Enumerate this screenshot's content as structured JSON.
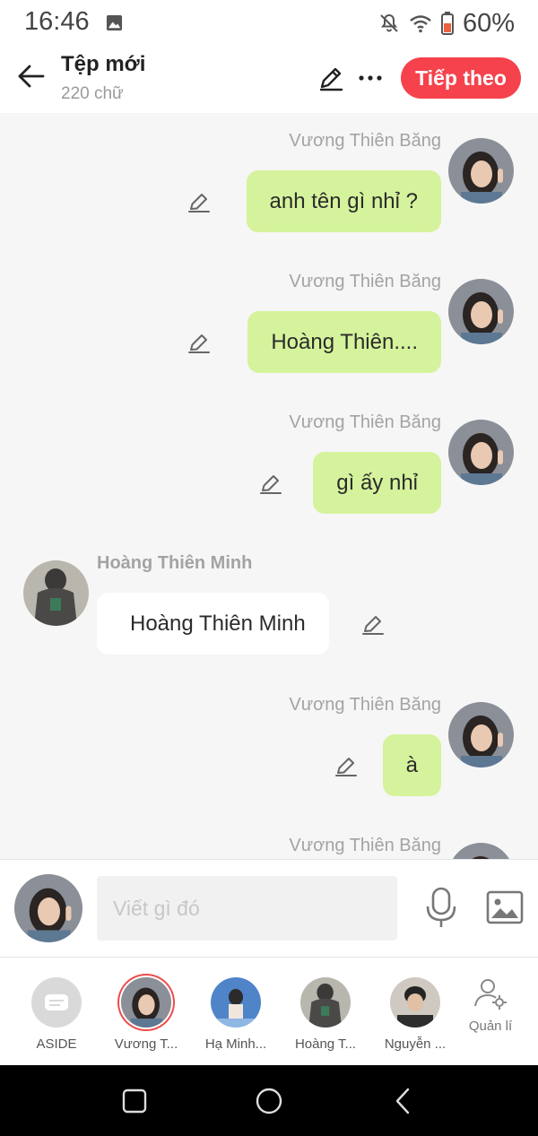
{
  "status_bar": {
    "time": "16:46",
    "battery": "60%",
    "icons": [
      "image-icon",
      "bell-off-icon",
      "wifi-icon",
      "battery-icon"
    ]
  },
  "header": {
    "title": "Tệp mới",
    "subtitle": "220 chữ",
    "next_label": "Tiếp theo",
    "icons": [
      "back-arrow-icon",
      "pencil-icon",
      "more-icon"
    ]
  },
  "messages": [
    {
      "side": "right",
      "sender": "Vương Thiên Băng",
      "text": "anh tên gì nhỉ ?"
    },
    {
      "side": "right",
      "sender": "Vương Thiên Băng",
      "text": "Hoàng Thiên...."
    },
    {
      "side": "right",
      "sender": "Vương Thiên Băng",
      "text": "gì ấy nhỉ"
    },
    {
      "side": "left",
      "sender": "Hoàng Thiên Minh",
      "text": "Hoàng Thiên Minh"
    },
    {
      "side": "right",
      "sender": "Vương Thiên Băng",
      "text": "à"
    },
    {
      "side": "right",
      "sender": "Vương Thiên Băng",
      "text": ""
    }
  ],
  "composer": {
    "placeholder": "Viết gì đó",
    "icons": [
      "microphone-icon",
      "image-icon"
    ]
  },
  "characters": [
    {
      "name": "ASIDE"
    },
    {
      "name": "Vương T...",
      "selected": true
    },
    {
      "name": "Hạ Minh..."
    },
    {
      "name": "Hoàng T..."
    },
    {
      "name": "Nguyễn ..."
    }
  ],
  "manage": {
    "label": "Quản lí"
  },
  "colors": {
    "accent": "#f5424c",
    "right_bubble": "#d5f39c",
    "left_bubble": "#ffffff",
    "background": "#f6f6f6"
  }
}
